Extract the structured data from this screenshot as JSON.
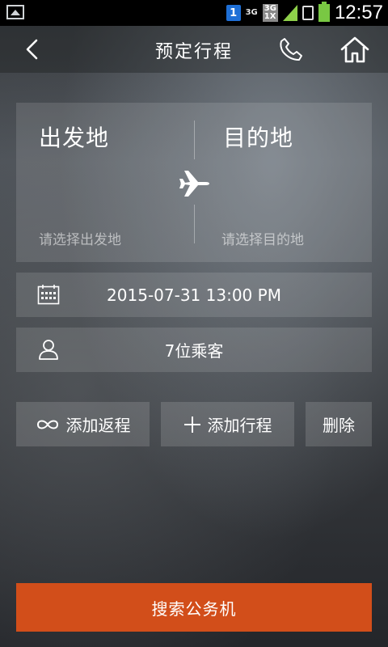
{
  "status_bar": {
    "time": "12:57",
    "sim_slot": "1",
    "network_1": "3G",
    "network_2": "3G\n1X",
    "colors": {
      "signal": "#8ed04a",
      "battery": "#79c843",
      "sim": "#1e6fd6"
    }
  },
  "header": {
    "title": "预定行程",
    "back_icon": "chevron-left-icon",
    "phone_icon": "phone-icon",
    "home_icon": "home-icon"
  },
  "route": {
    "origin_label": "出发地",
    "origin_hint": "请选择出发地",
    "destination_label": "目的地",
    "destination_hint": "请选择目的地",
    "swap_icon": "airplane-icon"
  },
  "date_row": {
    "icon": "calendar-icon",
    "value": "2015-07-31 13:00 PM"
  },
  "passenger_row": {
    "icon": "person-icon",
    "value": "7位乘客"
  },
  "actions": {
    "add_return": "添加返程",
    "add_trip": "添加行程",
    "delete": "删除"
  },
  "search_button": {
    "label": "搜索公务机",
    "color": "#d24e1a"
  }
}
